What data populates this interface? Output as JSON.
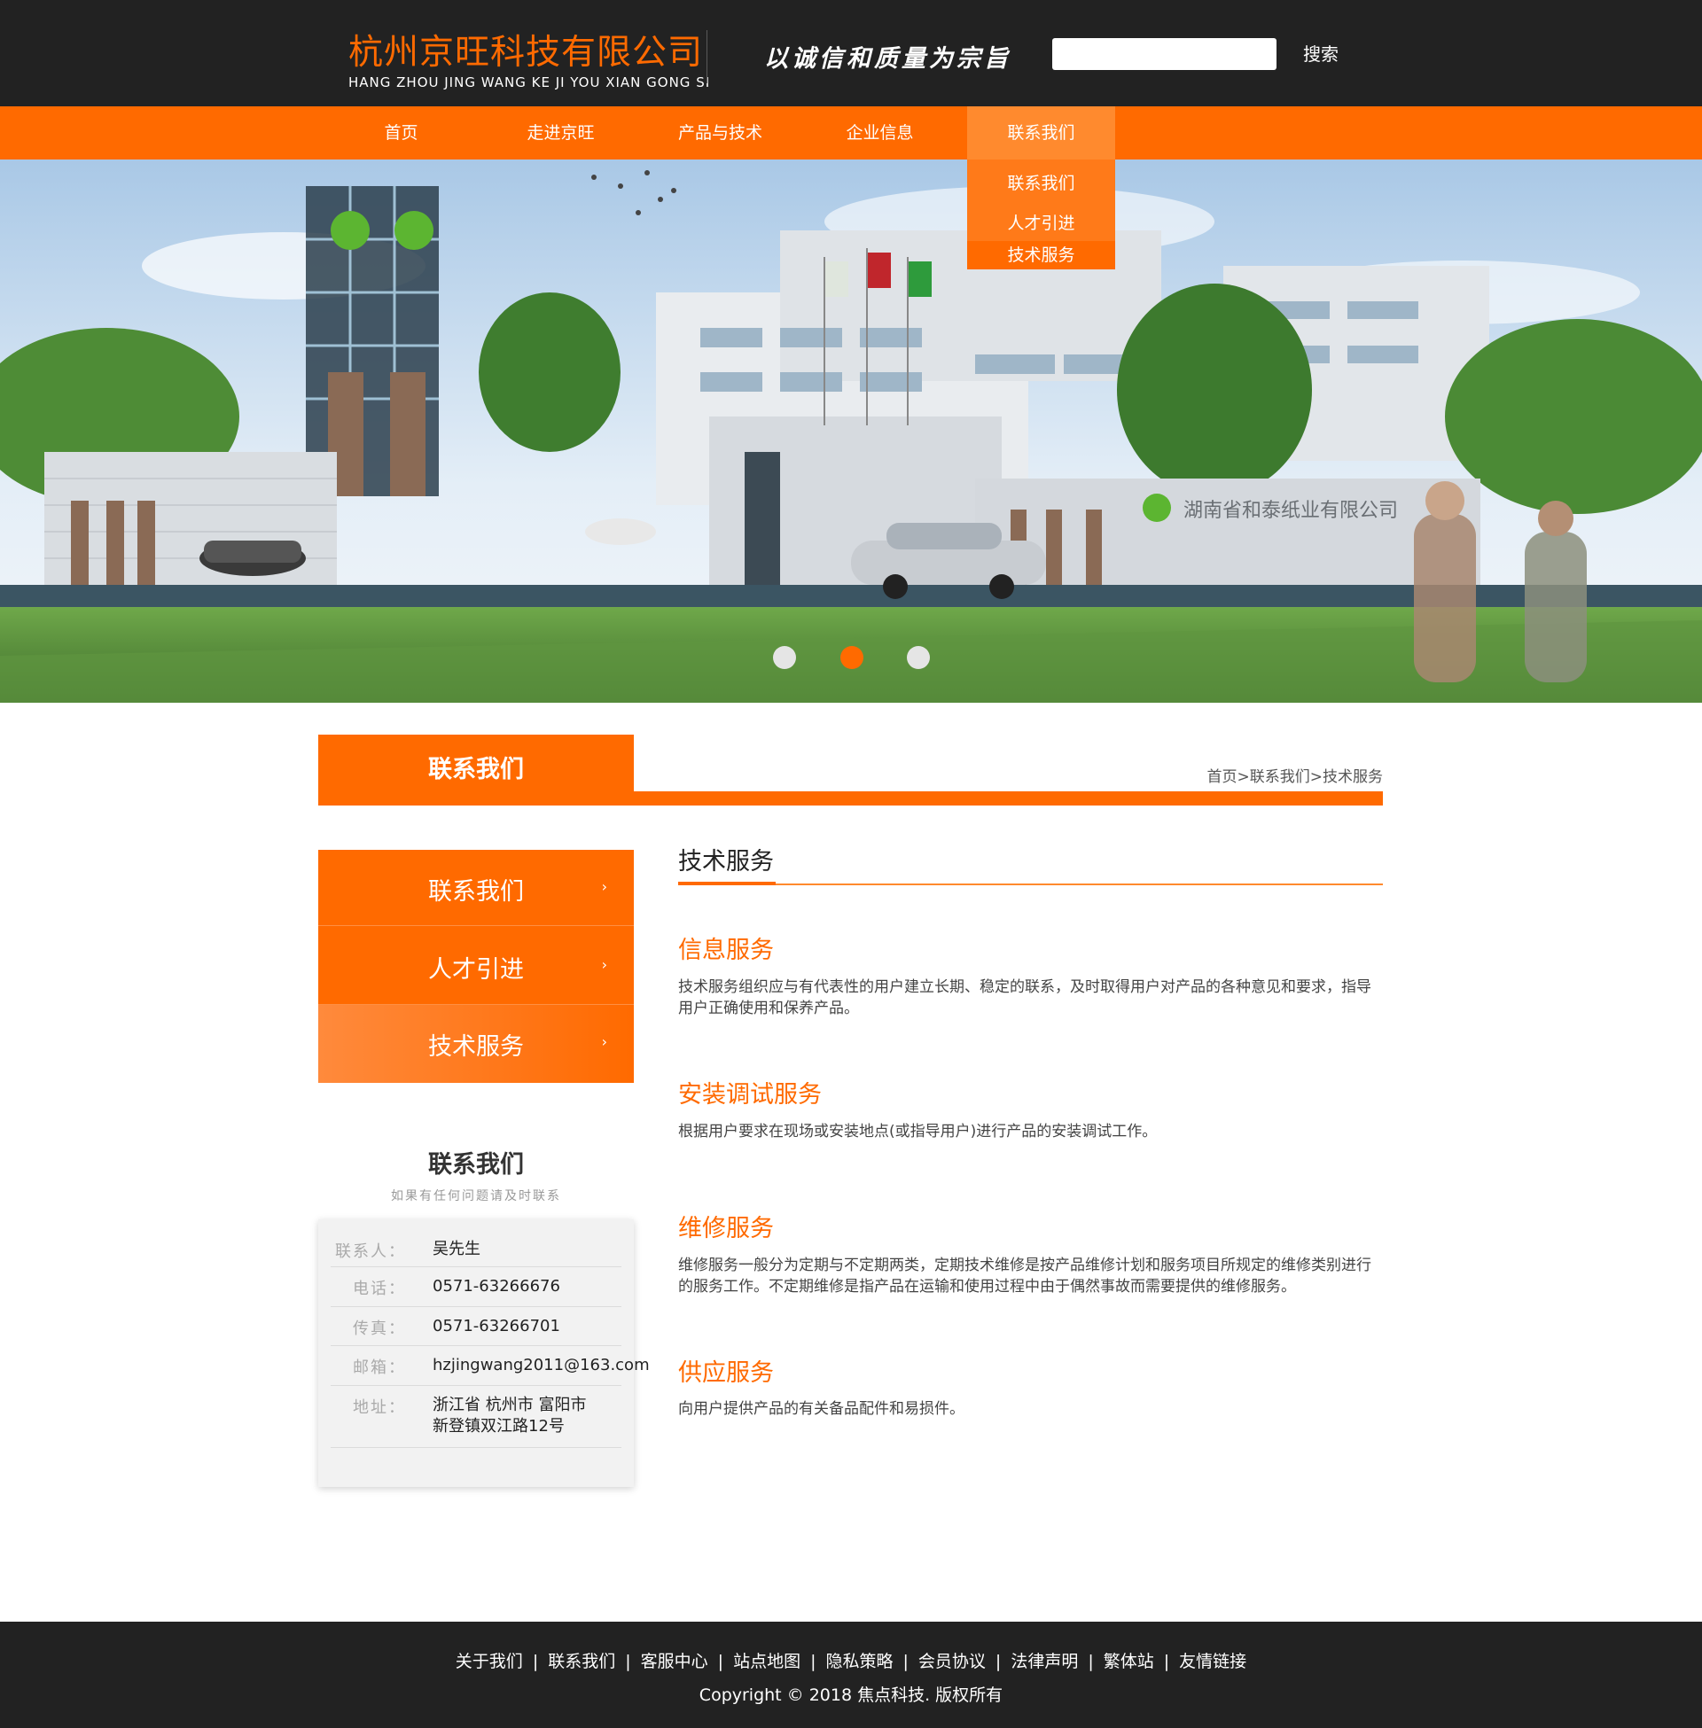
{
  "header": {
    "company_cn": "杭州京旺科技有限公司",
    "company_en": "HANG ZHOU JING WANG KE JI YOU XIAN GONG SI",
    "slogan": "以诚信和质量为宗旨",
    "search_placeholder": "",
    "search_label": "搜索"
  },
  "nav": {
    "items": [
      {
        "label": "首页"
      },
      {
        "label": "走进京旺"
      },
      {
        "label": "产品与技术"
      },
      {
        "label": "企业信息"
      },
      {
        "label": "联系我们"
      }
    ],
    "dropdown": [
      {
        "label": "联系我们"
      },
      {
        "label": "人才引进"
      },
      {
        "label": "技术服务"
      }
    ]
  },
  "banner": {
    "building_sign": "湖南省和泰纸业有限公司",
    "slides": 3,
    "active_slide": 2
  },
  "section": {
    "tab_title": "联系我们",
    "breadcrumb": [
      "首页",
      "联系我们",
      "技术服务"
    ],
    "breadcrumb_sep": ">"
  },
  "side_menu": {
    "items": [
      {
        "label": "联系我们"
      },
      {
        "label": "人才引进"
      },
      {
        "label": "技术服务"
      }
    ],
    "chevron": "›"
  },
  "contact": {
    "title": "联系我们",
    "subtitle": "如果有任何问题请及时联系",
    "rows": [
      {
        "key": "联系人：",
        "value": "吴先生"
      },
      {
        "key": "电话：",
        "value": "0571-63266676"
      },
      {
        "key": "传真：",
        "value": "0571-63266701"
      },
      {
        "key": "邮箱：",
        "value": "hzjingwang2011@163.com"
      },
      {
        "key": "地址：",
        "value": "浙江省 杭州市 富阳市",
        "value2": "新登镇双江路12号"
      }
    ]
  },
  "article": {
    "title": "技术服务",
    "sections": [
      {
        "heading": "信息服务",
        "body": "技术服务组织应与有代表性的用户建立长期、稳定的联系，及时取得用户对产品的各种意见和要求，指导用户正确使用和保养产品。"
      },
      {
        "heading": "安装调试服务",
        "body": "根据用户要求在现场或安装地点(或指导用户)进行产品的安装调试工作。"
      },
      {
        "heading": "维修服务",
        "body": "维修服务一般分为定期与不定期两类，定期技术维修是按产品维修计划和服务项目所规定的维修类别进行的服务工作。不定期维修是指产品在运输和使用过程中由于偶然事故而需要提供的维修服务。"
      },
      {
        "heading": "供应服务",
        "body": "向用户提供产品的有关备品配件和易损件。"
      }
    ]
  },
  "footer": {
    "links": [
      {
        "label": "关于我们"
      },
      {
        "label": "联系我们"
      },
      {
        "label": "客服中心"
      },
      {
        "label": "站点地图"
      },
      {
        "label": "隐私策略"
      },
      {
        "label": "会员协议"
      },
      {
        "label": "法律声明"
      },
      {
        "label": "繁体站"
      },
      {
        "label": "友情链接"
      }
    ],
    "separator": "|",
    "copyright": "Copyright © 2018 焦点科技. 版权所有"
  },
  "colors": {
    "accent": "#ff6a00",
    "dark": "#222222",
    "text": "#333333"
  }
}
